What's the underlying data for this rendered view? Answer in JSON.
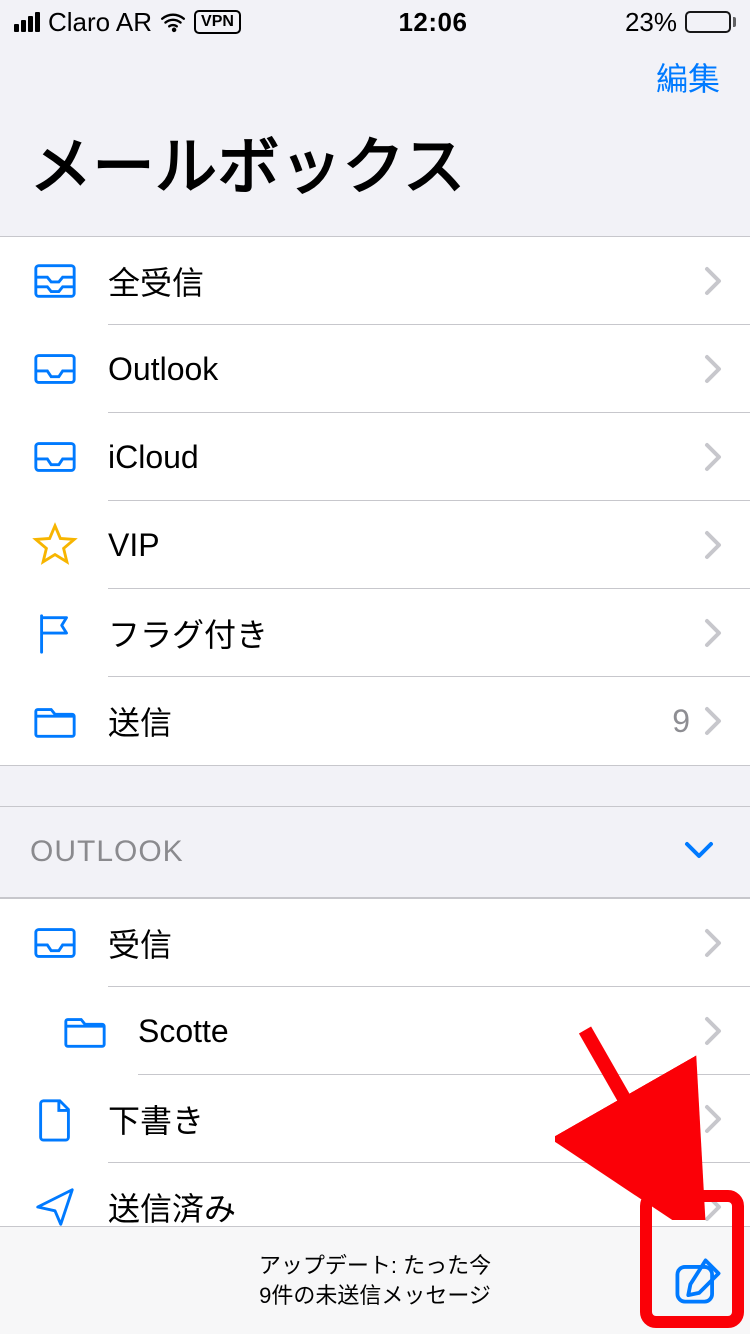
{
  "status": {
    "carrier": "Claro AR",
    "vpn": "VPN",
    "time": "12:06",
    "battery_pct": "23%"
  },
  "nav": {
    "edit": "編集",
    "title": "メールボックス"
  },
  "mailboxes": [
    {
      "key": "all-inboxes",
      "label": "全受信",
      "icon": "tray-full",
      "count": ""
    },
    {
      "key": "outlook",
      "label": "Outlook",
      "icon": "tray",
      "count": ""
    },
    {
      "key": "icloud",
      "label": "iCloud",
      "icon": "tray",
      "count": ""
    },
    {
      "key": "vip",
      "label": "VIP",
      "icon": "star",
      "count": ""
    },
    {
      "key": "flagged",
      "label": "フラグ付き",
      "icon": "flag",
      "count": ""
    },
    {
      "key": "outbox",
      "label": "送信",
      "icon": "folder",
      "count": "9"
    }
  ],
  "section": {
    "title": "OUTLOOK"
  },
  "outlook_items": [
    {
      "key": "inbox",
      "label": "受信",
      "icon": "tray",
      "indent": false
    },
    {
      "key": "scotte",
      "label": "Scotte",
      "icon": "folder",
      "indent": true
    },
    {
      "key": "drafts",
      "label": "下書き",
      "icon": "doc",
      "indent": false
    },
    {
      "key": "sent",
      "label": "送信済み",
      "icon": "send",
      "indent": false
    }
  ],
  "toolbar": {
    "line1": "アップデート: たった今",
    "line2": "9件の未送信メッセージ"
  }
}
